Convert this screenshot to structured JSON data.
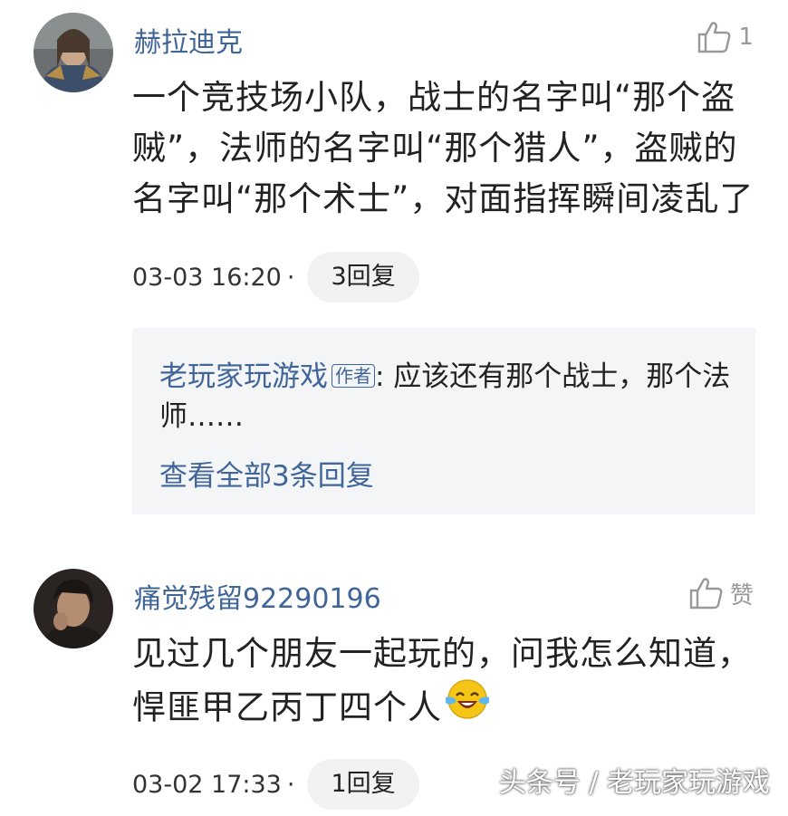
{
  "comments": [
    {
      "username": "赫拉迪克",
      "likes": "1",
      "text": "一个竞技场小队，战士的名字叫“那个盗贼”，法师的名字叫“那个猎人”，盗贼的名字叫“那个术士”，对面指挥瞬间凌乱了",
      "time": "03-03 16:20",
      "separator": "·",
      "reply_button": "3回复",
      "reply_preview": {
        "author": "老玩家玩游戏",
        "author_tag": "作者",
        "text": ": 应该还有那个战士，那个法师……",
        "see_all": "查看全部3条回复"
      }
    },
    {
      "username": "痛觉残留92290196",
      "likes": "赞",
      "text": "见过几个朋友一起玩的，问我怎么知道，悍匪甲乙丙丁四个人",
      "time": "03-02 17:33",
      "separator": "·",
      "reply_button": "1回复"
    }
  ],
  "watermark": "头条号 / 老玩家玩游戏",
  "colors": {
    "link": "#406599",
    "reply_bg": "#f4f5f6",
    "button_bg": "#f2f2f2"
  }
}
